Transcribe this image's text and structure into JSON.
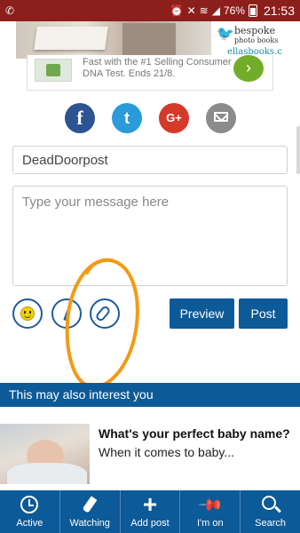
{
  "status_bar": {
    "battery": "76%",
    "time": "21:53"
  },
  "ads": {
    "top_brand_line1": "bespoke",
    "top_brand_line2": "photo books",
    "top_brand_url": "ellasbooks.co.uk",
    "dna_text": "Fast with the #1 Selling Consumer DNA Test. Ends 21/8.",
    "dna_go": "›"
  },
  "share": {
    "facebook": "f",
    "twitter": "t",
    "google": "G+"
  },
  "form": {
    "name_value": "DeadDoorpost",
    "message_placeholder": "Type your message here",
    "preview_label": "Preview",
    "post_label": "Post"
  },
  "related": {
    "header": "This may also interest you",
    "title": "What's your perfect baby name?",
    "snippet": "When it comes to baby..."
  },
  "nav": {
    "items": [
      {
        "label": "Active"
      },
      {
        "label": "Watching"
      },
      {
        "label": "Add post"
      },
      {
        "label": "I'm on"
      },
      {
        "label": "Search"
      }
    ]
  },
  "colors": {
    "status_bar": "#8c1f1c",
    "primary": "#0d5a98",
    "annotation": "#f39a16"
  }
}
